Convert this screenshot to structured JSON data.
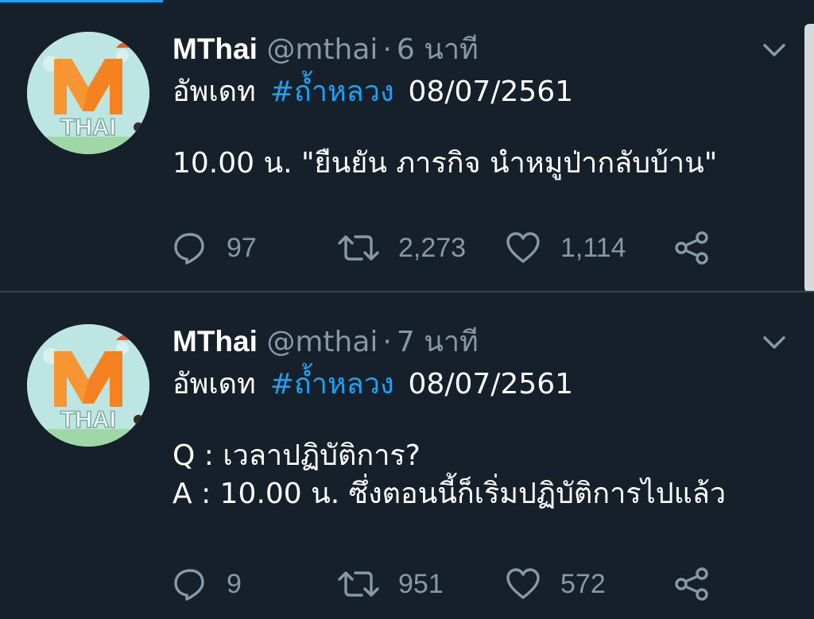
{
  "tweets": [
    {
      "author_name": "MThai",
      "handle": "@mthai",
      "separator": "·",
      "time": "6 นาที",
      "line1": {
        "prefix": "อัพเดท",
        "hashtag": "#ถ้ำหลวง",
        "date": "08/07/2561"
      },
      "body_lines": [
        "10.00 น. \"ยืนยัน ภารกิจ นำหมูป่ากลับบ้าน\""
      ],
      "replies": "97",
      "retweets": "2,273",
      "likes": "1,114"
    },
    {
      "author_name": "MThai",
      "handle": "@mthai",
      "separator": "·",
      "time": "7 นาที",
      "line1": {
        "prefix": "อัพเดท",
        "hashtag": "#ถ้ำหลวง",
        "date": "08/07/2561"
      },
      "body_lines": [
        "Q : เวลาปฏิบัติการ?",
        "A : 10.00 น. ซึ่งตอนนี้ก็เริ่มปฏิบัติการไปแล้ว"
      ],
      "replies": "9",
      "retweets": "951",
      "likes": "572"
    }
  ],
  "avatar_logo": {
    "letter": "M",
    "word": "THAI"
  },
  "icons": {
    "reply": "reply-icon",
    "retweet": "retweet-icon",
    "like": "like-icon",
    "share": "share-icon",
    "menu": "chevron-down-icon"
  },
  "colors": {
    "background": "#15202b",
    "accent": "#1da1f2",
    "muted": "#8899a6",
    "divider": "#38444d",
    "logo_orange": "#f58220"
  }
}
